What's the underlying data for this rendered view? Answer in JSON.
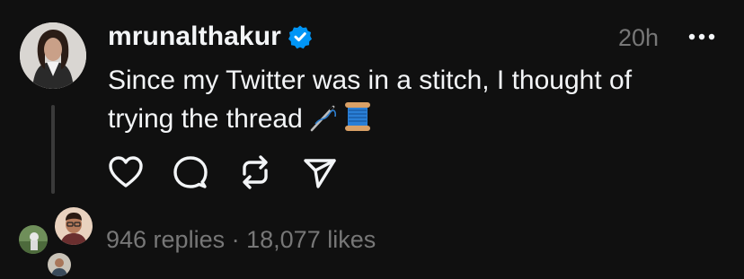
{
  "post": {
    "username": "mrunalthakur",
    "verified_icon": "verified-badge-icon",
    "timestamp": "20h",
    "text_line1": "Since my Twitter was in a stitch, I thought of",
    "text_line2": "trying the thread",
    "emoji_icons": [
      "sewing-needle-icon",
      "spool-of-thread-icon"
    ]
  },
  "actions": [
    {
      "icon": "heart-icon"
    },
    {
      "icon": "comment-icon"
    },
    {
      "icon": "repost-icon"
    },
    {
      "icon": "share-icon"
    }
  ],
  "stats": {
    "replies": "946 replies",
    "separator": "·",
    "likes": "18,077 likes"
  },
  "colors": {
    "background": "#101010",
    "text": "#f3f5f7",
    "muted": "#777777",
    "verified": "#0095f6",
    "thread_line": "#3a3a3a"
  }
}
